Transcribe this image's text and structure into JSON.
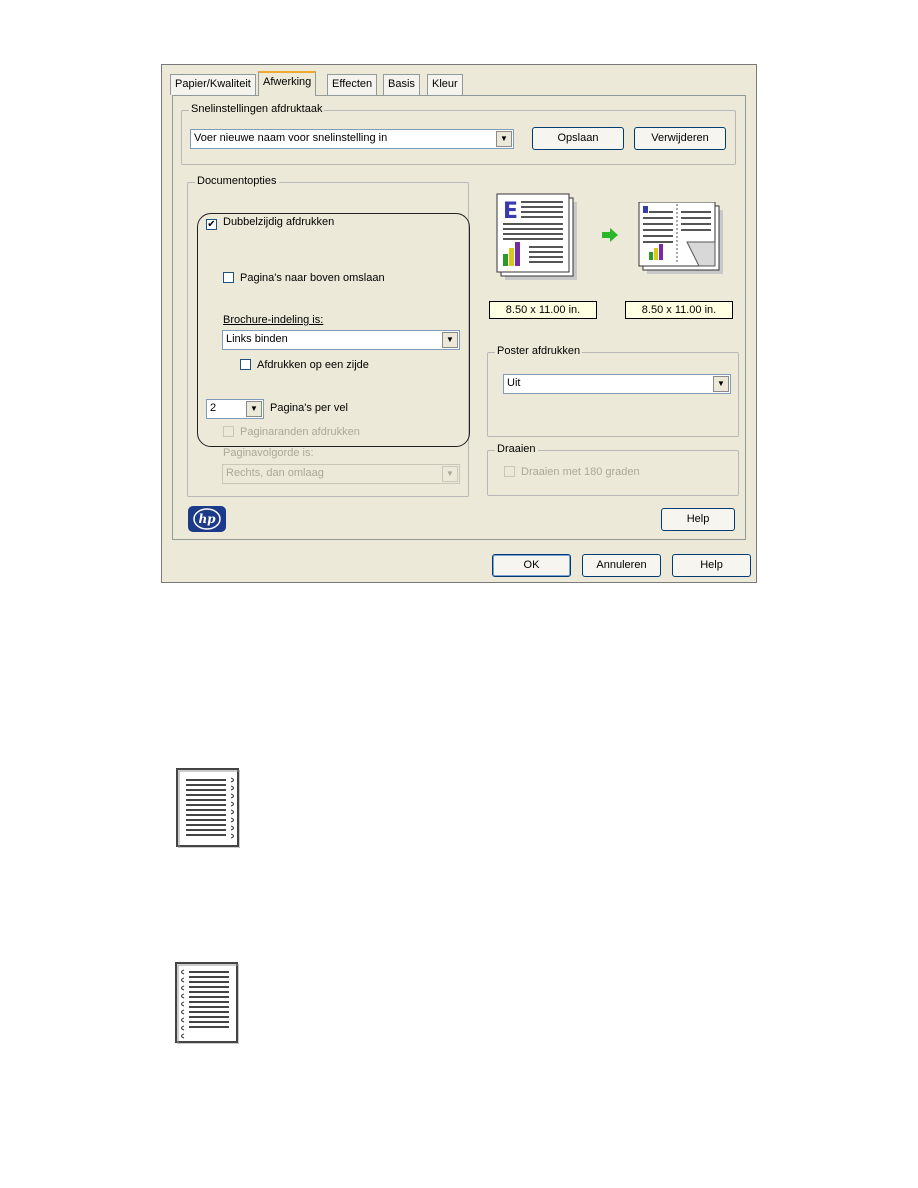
{
  "tabs": [
    "Papier/Kwaliteit",
    "Afwerking",
    "Effecten",
    "Basis",
    "Kleur"
  ],
  "active_tab": "Afwerking",
  "quick_sets": {
    "legend": "Snelinstellingen afdruktaak",
    "select_value": "Voer nieuwe naam voor snelinstelling in",
    "save_button": "Opslaan",
    "delete_button": "Verwijderen"
  },
  "doc_options": {
    "legend": "Documentopties",
    "duplex_label": "Dubbelzijdig afdrukken",
    "duplex_checked": true,
    "flip_up_label": "Pagina's naar boven omslaan",
    "booklet_label": "Brochure-indeling is:",
    "booklet_value": "Links binden",
    "one_side_label": "Afdrukken op een zijde",
    "pages_per_sheet_value": "2",
    "pages_per_sheet_label": "Pagina's per vel",
    "borders_label": "Paginaranden afdrukken",
    "page_order_label": "Paginavolgorde is:",
    "page_order_value": "Rechts, dan omlaag"
  },
  "preview": {
    "size_left": "8.50 x 11.00 in.",
    "size_right": "8.50 x 11.00 in."
  },
  "poster": {
    "legend": "Poster afdrukken",
    "value": "Uit"
  },
  "rotate": {
    "legend": "Draaien",
    "label": "Draaien met 180 graden"
  },
  "help_button": "Help",
  "footer": {
    "ok": "OK",
    "cancel": "Annuleren",
    "help": "Help"
  },
  "icons": [
    "hp-logo-icon",
    "document-preview-icon",
    "booklet-preview-icon",
    "arrow-right-icon",
    "binding-right-icon",
    "binding-left-icon"
  ]
}
